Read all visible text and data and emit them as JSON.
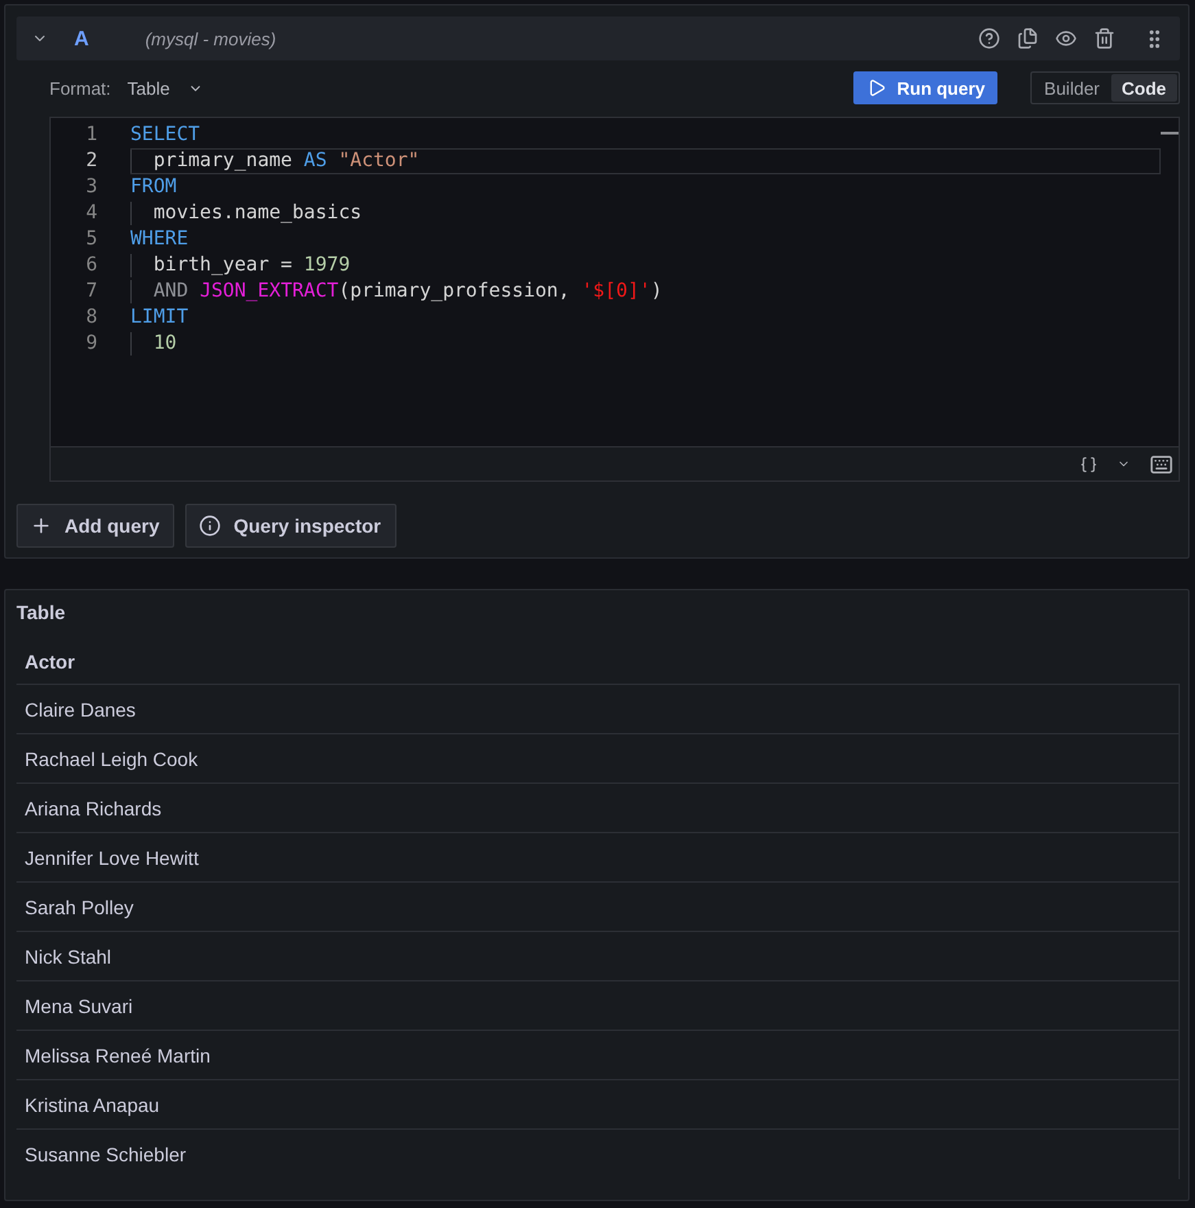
{
  "query": {
    "expanded": true,
    "ref_id": "A",
    "datasource": "(mysql - movies)"
  },
  "format": {
    "label": "Format:",
    "value": "Table"
  },
  "run_button": "Run query",
  "mode_toggle": [
    {
      "label": "Builder",
      "selected": false
    },
    {
      "label": "Code",
      "selected": true
    }
  ],
  "editor": {
    "lines": [
      {
        "number": "1",
        "current": false,
        "indented": false,
        "tokens": [
          {
            "kind": "keyword",
            "text": "SELECT"
          }
        ]
      },
      {
        "number": "2",
        "current": true,
        "indented": true,
        "tokens": [
          {
            "kind": "plain",
            "text": "primary_name "
          },
          {
            "kind": "keyword",
            "text": "AS"
          },
          {
            "kind": "identifier",
            "text": " \"Actor\""
          }
        ]
      },
      {
        "number": "3",
        "current": false,
        "indented": false,
        "tokens": [
          {
            "kind": "keyword",
            "text": "FROM"
          }
        ]
      },
      {
        "number": "4",
        "current": false,
        "indented": true,
        "tokens": [
          {
            "kind": "plain",
            "text": "movies.name_basics"
          }
        ]
      },
      {
        "number": "5",
        "current": false,
        "indented": false,
        "tokens": [
          {
            "kind": "keyword",
            "text": "WHERE"
          }
        ]
      },
      {
        "number": "6",
        "current": false,
        "indented": true,
        "tokens": [
          {
            "kind": "plain",
            "text": "birth_year = "
          },
          {
            "kind": "number",
            "text": "1979"
          }
        ]
      },
      {
        "number": "7",
        "current": false,
        "indented": true,
        "tokens": [
          {
            "kind": "operator",
            "text": "AND "
          },
          {
            "kind": "function",
            "text": "JSON_EXTRACT"
          },
          {
            "kind": "plain",
            "text": "(primary_profession, "
          },
          {
            "kind": "string",
            "text": "'$[0]'"
          },
          {
            "kind": "plain",
            "text": ")"
          }
        ]
      },
      {
        "number": "8",
        "current": false,
        "indented": false,
        "tokens": [
          {
            "kind": "keyword",
            "text": "LIMIT"
          }
        ]
      },
      {
        "number": "9",
        "current": false,
        "indented": true,
        "tokens": [
          {
            "kind": "number",
            "text": "10"
          }
        ]
      }
    ]
  },
  "actions": [
    {
      "kind": "add",
      "label": "Add query"
    },
    {
      "kind": "inspect",
      "label": "Query inspector"
    }
  ],
  "table_panel": {
    "title": "Table",
    "columns": [
      "Actor"
    ],
    "rows": [
      [
        "Claire Danes"
      ],
      [
        "Rachael Leigh Cook"
      ],
      [
        "Ariana Richards"
      ],
      [
        "Jennifer Love Hewitt"
      ],
      [
        "Sarah Polley"
      ],
      [
        "Nick Stahl"
      ],
      [
        "Mena Suvari"
      ],
      [
        "Melissa Reneé Martin"
      ],
      [
        "Kristina Anapau"
      ],
      [
        "Susanne Schiebler"
      ]
    ]
  }
}
